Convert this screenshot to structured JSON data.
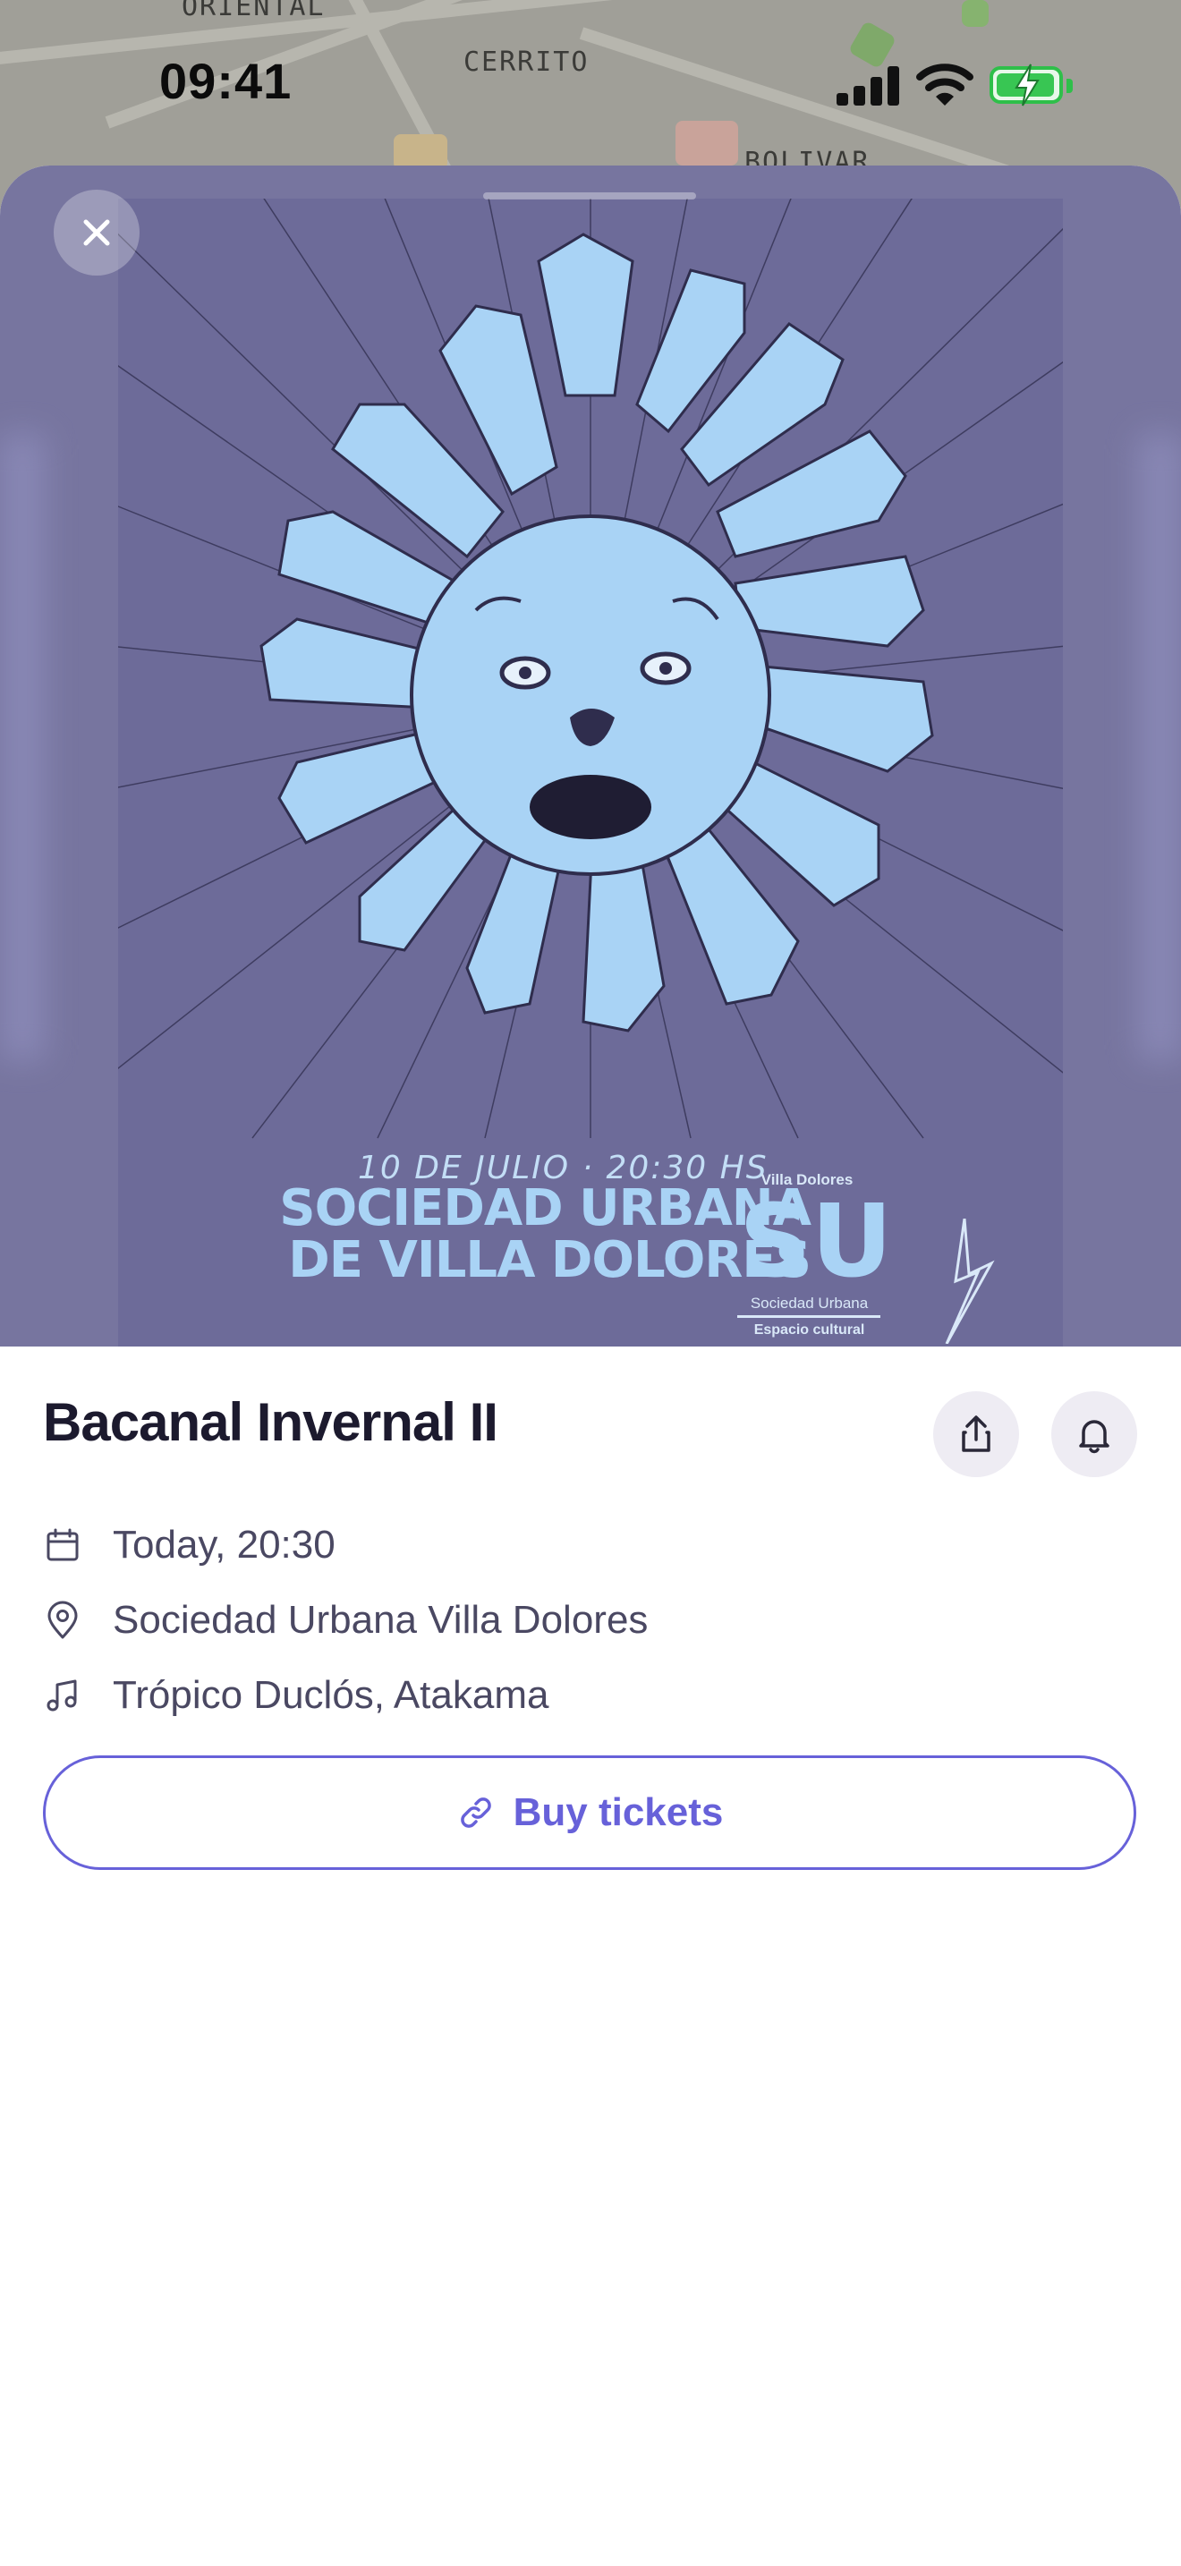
{
  "map": {
    "labels": [
      "ORIENTAL",
      "CERRITO",
      "BOLIVAR"
    ]
  },
  "status_bar": {
    "time": "09:41"
  },
  "poster": {
    "date_line": "10 DE JULIO · 20:30 HS",
    "venue_line1": "SOCIEDAD URBANA",
    "venue_line2": "DE VILLA DOLORES",
    "logo_top": "Villa Dolores",
    "logo_mark": "SU",
    "logo_name": "Sociedad Urbana",
    "logo_sub": "Espacio cultural",
    "colors": {
      "background": "#6d6b99",
      "ink": "#a9d3f5"
    }
  },
  "event": {
    "title": "Bacanal Invernal II",
    "datetime": "Today, 20:30",
    "venue": "Sociedad Urbana Villa Dolores",
    "artists": "Trópico Duclós, Atakama",
    "buy_label": "Buy tickets"
  },
  "icons": {
    "close": "close-icon",
    "share": "share-icon",
    "notify": "bell-icon",
    "date": "calendar-icon",
    "venue": "map-pin-icon",
    "artists": "music-note-icon",
    "buy": "link-icon"
  },
  "colors": {
    "accent": "#6761d9",
    "title": "#1c1a2e",
    "text": "#4a4862",
    "hero_bg": "#77759f"
  }
}
